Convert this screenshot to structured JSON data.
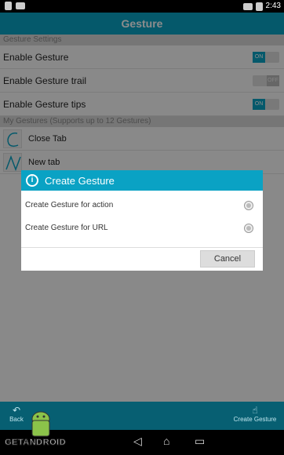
{
  "status_bar": {
    "time": "2:43"
  },
  "app_bar": {
    "title": "Gesture"
  },
  "settings": {
    "section_title": "Gesture Settings",
    "rows": [
      {
        "label": "Enable Gesture",
        "state": "ON"
      },
      {
        "label": "Enable Gesture trail",
        "state": "OFF"
      },
      {
        "label": "Enable Gesture tips",
        "state": "ON"
      }
    ]
  },
  "gestures": {
    "section_title": "My Gestures (Supports up to 12 Gestures)",
    "items": [
      {
        "label": "Close Tab",
        "glyph": "C"
      },
      {
        "label": "New tab",
        "glyph": "N"
      }
    ]
  },
  "dialog": {
    "title": "Create Gesture",
    "options": [
      {
        "label": "Create Gesture for action"
      },
      {
        "label": "Create Gesture for URL"
      }
    ],
    "cancel_label": "Cancel"
  },
  "bottom_bar": {
    "back_label": "Back",
    "create_label": "Create Gesture"
  },
  "watermark": {
    "text": "GETANDROID"
  },
  "colors": {
    "accent": "#0aa2c4",
    "bottom_bar": "#075f72"
  }
}
